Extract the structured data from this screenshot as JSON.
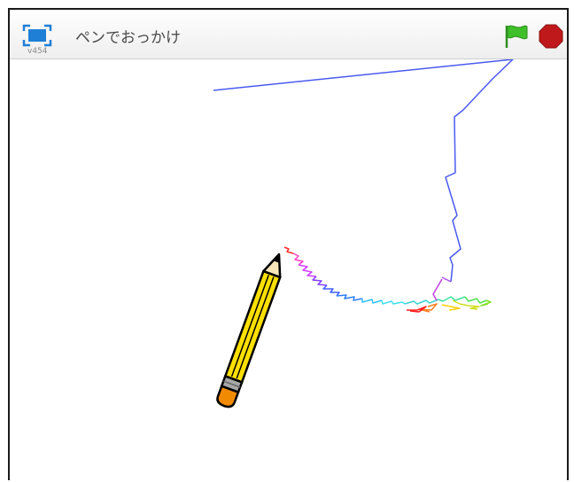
{
  "toolbar": {
    "version": "v454",
    "title": "ペンでおっかけ",
    "fullscreen_icon": "fullscreen-icon",
    "flag_icon": "green-flag-icon",
    "stop_icon": "stop-sign-icon"
  },
  "colors": {
    "fullscreen": "#1f7fd6",
    "flag": "#3fbf2a",
    "stop": "#c0191b",
    "pencil_body": "#ffe000",
    "pencil_eraser": "#f28a00"
  }
}
